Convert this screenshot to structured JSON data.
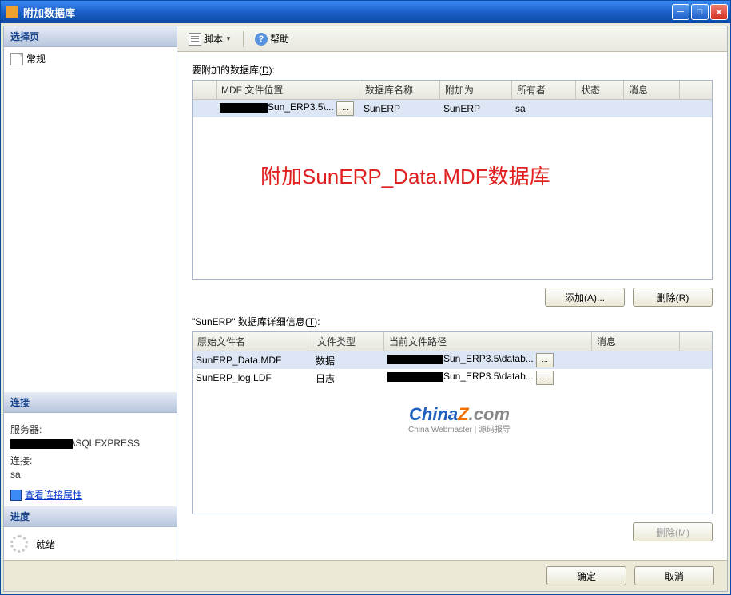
{
  "title": "附加数据库",
  "sidebar": {
    "select_page": "选择页",
    "general": "常规",
    "connection": "连接",
    "server_label": "服务器:",
    "server_suffix": "\\SQLEXPRESS",
    "conn_label": "连接:",
    "conn_value": "sa",
    "view_props": "查看连接属性",
    "progress": "进度",
    "status": "就绪"
  },
  "toolbar": {
    "script": "脚本",
    "help": "帮助"
  },
  "main": {
    "attach_label_pre": "要附加的数据库(",
    "attach_label_u": "D",
    "attach_label_suf": "):",
    "grid1": {
      "headers": [
        "",
        "MDF 文件位置",
        "数据库名称",
        "附加为",
        "所有者",
        "状态",
        "消息"
      ],
      "row": {
        "mdf_suffix": "Sun_ERP3.5\\...",
        "browse": "...",
        "dbname": "SunERP",
        "attach_as": "SunERP",
        "owner": "sa"
      }
    },
    "overlay": "附加SunERP_Data.MDF数据库",
    "add_btn": "添加(A)...",
    "remove_btn": "删除(R)",
    "details_pre": "\"SunERP\" 数据库详细信息(",
    "details_u": "T",
    "details_suf": "):",
    "grid2": {
      "headers": [
        "原始文件名",
        "文件类型",
        "当前文件路径",
        "消息"
      ],
      "rows": [
        {
          "name": "SunERP_Data.MDF",
          "type": "数据",
          "path_suffix": "Sun_ERP3.5\\datab..."
        },
        {
          "name": "SunERP_log.LDF",
          "type": "日志",
          "path_suffix": "Sun_ERP3.5\\datab..."
        }
      ]
    },
    "remove2_btn": "删除(M)"
  },
  "watermark": {
    "top1": "China",
    "top2": "Z",
    "top3": ".com",
    "bottom": "China Webmaster | 源码报导"
  },
  "footer": {
    "ok": "确定",
    "cancel": "取消"
  }
}
